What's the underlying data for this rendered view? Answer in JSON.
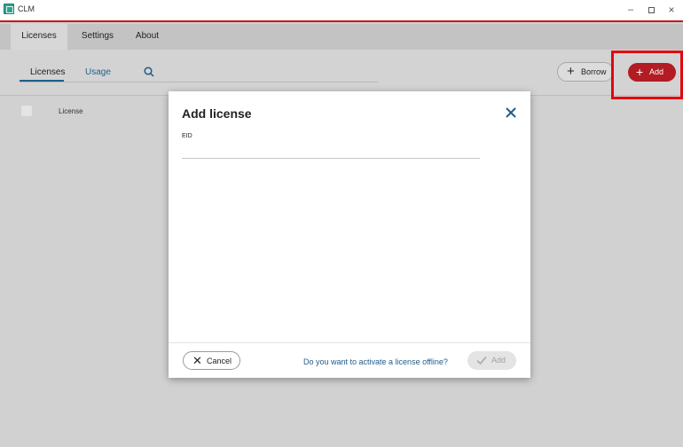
{
  "window": {
    "title": "CLM",
    "minimize_glyph": "–",
    "close_glyph": "×"
  },
  "main_tabs": [
    {
      "label": "Licenses",
      "active": true
    },
    {
      "label": "Settings",
      "active": false
    },
    {
      "label": "About",
      "active": false
    }
  ],
  "sub_tabs": [
    {
      "label": "Licenses",
      "active": true
    },
    {
      "label": "Usage",
      "active": false
    }
  ],
  "toolbar": {
    "borrow_label": "Borrow",
    "add_label": "Add",
    "icons": [
      "search-icon",
      "plus-icon"
    ]
  },
  "table": {
    "columns": [
      "License"
    ]
  },
  "dialog": {
    "title": "Add license",
    "eid_label": "EID",
    "eid_value": "",
    "cancel_label": "Cancel",
    "offline_link": "Do you want to activate a license offline?",
    "add_label": "Add"
  },
  "colors": {
    "accent_red": "#b21c22",
    "highlight": "#e1070e",
    "link_blue": "#1f5b8a"
  }
}
